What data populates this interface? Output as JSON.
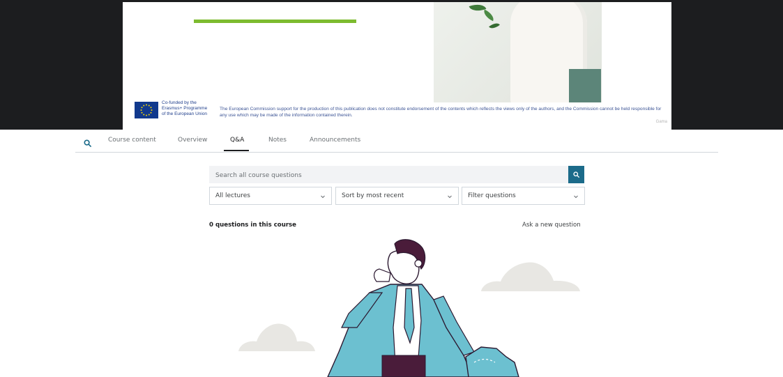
{
  "slide": {
    "eu_label_lines": [
      "Co-funded by the",
      "Erasmus+ Programme",
      "of the European Union"
    ],
    "disclaimer": "The European Commission support for the production of this publication does not constitute endorsement of the contents which reflects the views only of the authors, and the Commission cannot be held responsible for any  use which may be made of the information contained therein.",
    "watermark": "Gama",
    "accent_color": "#7dbb2f"
  },
  "tabs": {
    "search_icon": "search-icon",
    "items": [
      {
        "label": "Course content"
      },
      {
        "label": "Overview"
      },
      {
        "label": "Q&A",
        "active": true
      },
      {
        "label": "Notes"
      },
      {
        "label": "Announcements"
      }
    ]
  },
  "qa": {
    "search_placeholder": "Search all course questions",
    "filters": {
      "lectures": "All lectures",
      "sort": "Sort by most recent",
      "questions": "Filter questions"
    },
    "count_text": "0 questions in this course",
    "ask_label": "Ask a new question"
  },
  "colors": {
    "brand_teal": "#1c6b8a",
    "illustration_blue": "#6cc0d0",
    "illustration_plum": "#4a1c3a"
  }
}
